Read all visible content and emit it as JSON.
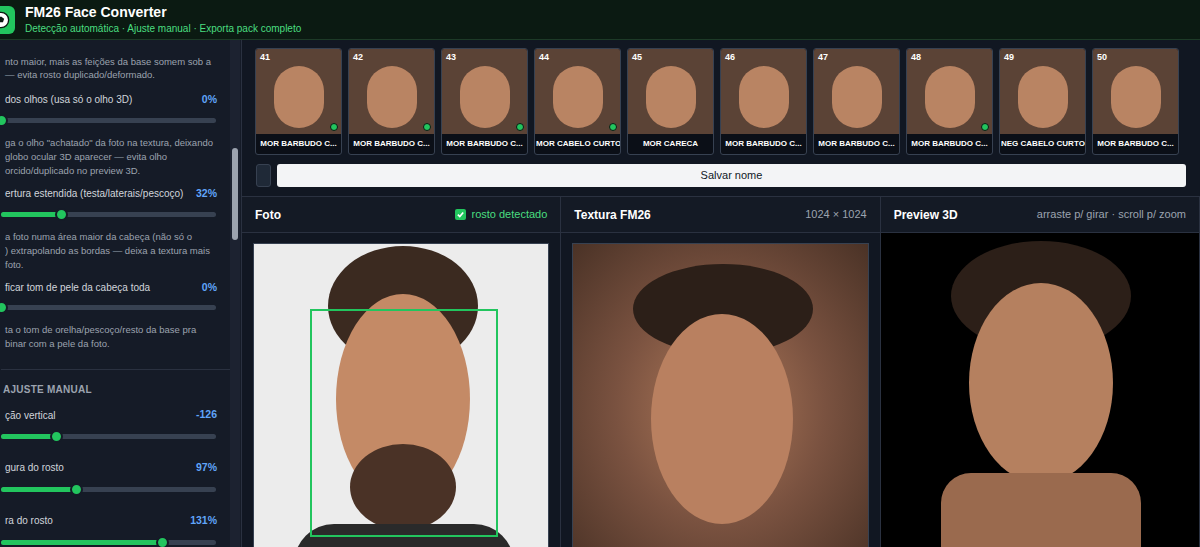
{
  "header": {
    "title": "FM26 Face Converter",
    "subtitle": "Detecção automática · Ajuste manual · Exporta pack completo"
  },
  "sidebar": {
    "intro": [
      "nto maior, mais as feições da base somem sob a",
      "— evita rosto duplicado/deformado."
    ],
    "settings": [
      {
        "label": "dos olhos (usa só o olho 3D)",
        "reading": "0%",
        "level": 0,
        "description": [
          "ga o olho \"achatado\" da foto na textura, deixando",
          "globo ocular 3D aparecer — evita olho",
          "orcido/duplicado no preview 3D."
        ]
      },
      {
        "label": "ertura estendida (testa/laterais/pescoço)",
        "reading": "32%",
        "level": 0.28,
        "description": [
          "a foto numa área maior da cabeça (não só o",
          ") extrapolando as bordas — deixa a textura mais",
          "foto."
        ]
      },
      {
        "label": "ficar tom de pele da cabeça toda",
        "reading": "0%",
        "level": 0,
        "description": [
          "ta o tom de orelha/pescoço/resto da base pra",
          "binar com a pele da foto."
        ]
      }
    ],
    "section_title": "AJUSTE MANUAL",
    "manual": [
      {
        "label": "ção vertical",
        "reading": "-126",
        "level": 0.26
      },
      {
        "label": "gura do rosto",
        "reading": "97%",
        "level": 0.35
      },
      {
        "label": "ra do rosto",
        "reading": "131%",
        "level": 0.75
      }
    ]
  },
  "thumbnails": [
    {
      "number": "41",
      "label": "MOR BARBUDO C...",
      "saved": true
    },
    {
      "number": "42",
      "label": "MOR BARBUDO C...",
      "saved": true
    },
    {
      "number": "43",
      "label": "MOR BARBUDO C...",
      "saved": true
    },
    {
      "number": "44",
      "label": "MOR CABELO CURTO",
      "saved": true
    },
    {
      "number": "45",
      "label": "MOR CARECA",
      "saved": false
    },
    {
      "number": "46",
      "label": "MOR BARBUDO C...",
      "saved": false
    },
    {
      "number": "47",
      "label": "MOR BARBUDO C...",
      "saved": false
    },
    {
      "number": "48",
      "label": "MOR BARBUDO C...",
      "saved": true
    },
    {
      "number": "49",
      "label": "NEG CABELO CURTO",
      "saved": false
    },
    {
      "number": "50",
      "label": "MOR BARBUDO C...",
      "saved": false
    }
  ],
  "save_button": "Salvar nome",
  "panels": {
    "photo": {
      "title": "Foto",
      "face_detected": true,
      "status": "rosto detectado"
    },
    "texture": {
      "title": "Textura FM26",
      "size": "1024 × 1024"
    },
    "preview": {
      "title": "Preview 3D",
      "hint": "arraste p/ girar · scroll p/ zoom"
    }
  }
}
